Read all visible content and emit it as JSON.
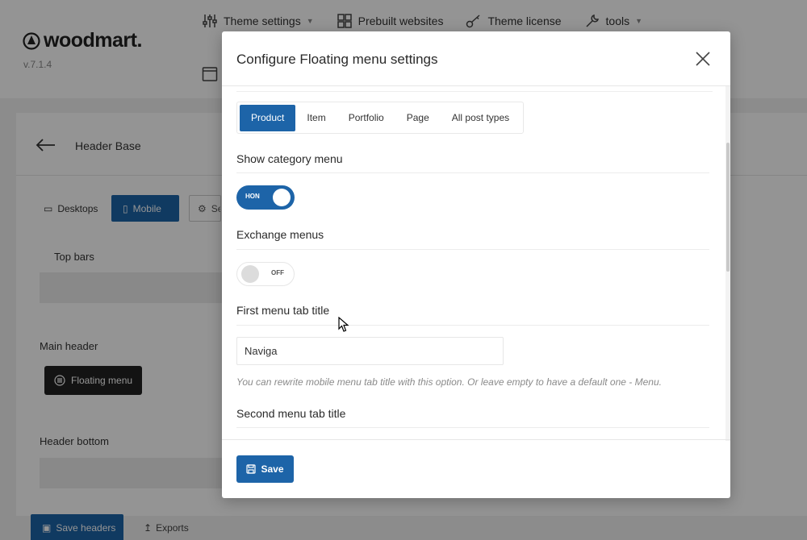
{
  "brand": {
    "name": "woodmart.",
    "version": "v.7.1.4"
  },
  "top_nav": [
    {
      "label": "Theme settings",
      "icon": "sliders-icon",
      "has_caret": true
    },
    {
      "label": "Prebuilt websites",
      "icon": "grid-icon",
      "has_caret": false
    },
    {
      "label": "Theme license",
      "icon": "key-icon",
      "has_caret": false
    },
    {
      "label": "tools",
      "icon": "wrench-icon",
      "has_caret": true
    }
  ],
  "builder": {
    "title": "Header Base",
    "devices": {
      "desktop": "Desktops",
      "mobile": "Mobile",
      "settings": "Se"
    },
    "areas": {
      "top": "Top bars",
      "main": "Main header",
      "bottom": "Header bottom"
    },
    "floating_menu_label": "Floating menu",
    "save_headers": "Save headers",
    "exports": "Exports"
  },
  "modal": {
    "title": "Configure Floating menu settings",
    "tabs": [
      "Product",
      "Item",
      "Portfolio",
      "Page",
      "All post types"
    ],
    "active_tab": "Product",
    "show_category_menu": {
      "label": "Show category menu",
      "state_text": "HON",
      "on": true
    },
    "exchange_menus": {
      "label": "Exchange menus",
      "state_text": "OFF",
      "on": false
    },
    "first_menu_tab_title": {
      "label": "First menu tab title",
      "value": "Naviga",
      "help": "You can rewrite mobile menu tab title with this option. Or leave empty to have a default one - Menu."
    },
    "second_menu_tab_title": {
      "label": "Second menu tab title"
    },
    "save_label": "Save"
  },
  "colors": {
    "accent": "#1d64a8",
    "dark_button": "#222222"
  }
}
